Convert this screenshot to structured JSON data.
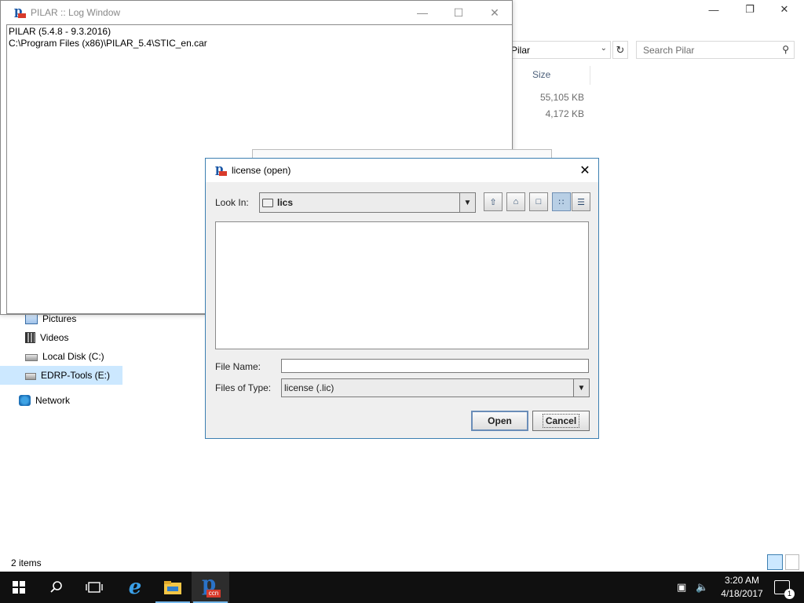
{
  "explorer": {
    "address_tail": "Pilar",
    "search_placeholder": "Search Pilar",
    "column_size": "Size",
    "file_sizes": [
      "55,105 KB",
      "4,172 KB"
    ],
    "nav": [
      {
        "label": "Pictures",
        "icon": "pictures-icon"
      },
      {
        "label": "Videos",
        "icon": "videos-icon"
      },
      {
        "label": "Local Disk (C:)",
        "icon": "drive-icon"
      },
      {
        "label": "EDRP-Tools (E:)",
        "icon": "network-drive-icon",
        "selected": true
      },
      {
        "label": "Network",
        "icon": "network-icon"
      }
    ],
    "status": "2 items"
  },
  "log_window": {
    "title": "PILAR :: Log Window",
    "lines": [
      "PILAR (5.4.8 - 9.3.2016)",
      "C:\\Program Files (x86)\\PILAR_5.4\\STIC_en.car"
    ]
  },
  "dialog": {
    "title": "license (open)",
    "look_in_label": "Look In:",
    "look_in_value": "lics",
    "file_name_label": "File Name:",
    "file_name_value": "",
    "files_of_type_label": "Files of Type:",
    "files_of_type_value": "license (.lic)",
    "open_label": "Open",
    "cancel_label": "Cancel"
  },
  "taskbar": {
    "time": "3:20 AM",
    "date": "4/18/2017",
    "notification_count": "1",
    "app_badge": "ccn"
  },
  "colors": {
    "dialog_border": "#3c7fb1",
    "taskbar": "#101010",
    "accent": "#76b9ed",
    "selected_nav": "#cce8ff"
  }
}
